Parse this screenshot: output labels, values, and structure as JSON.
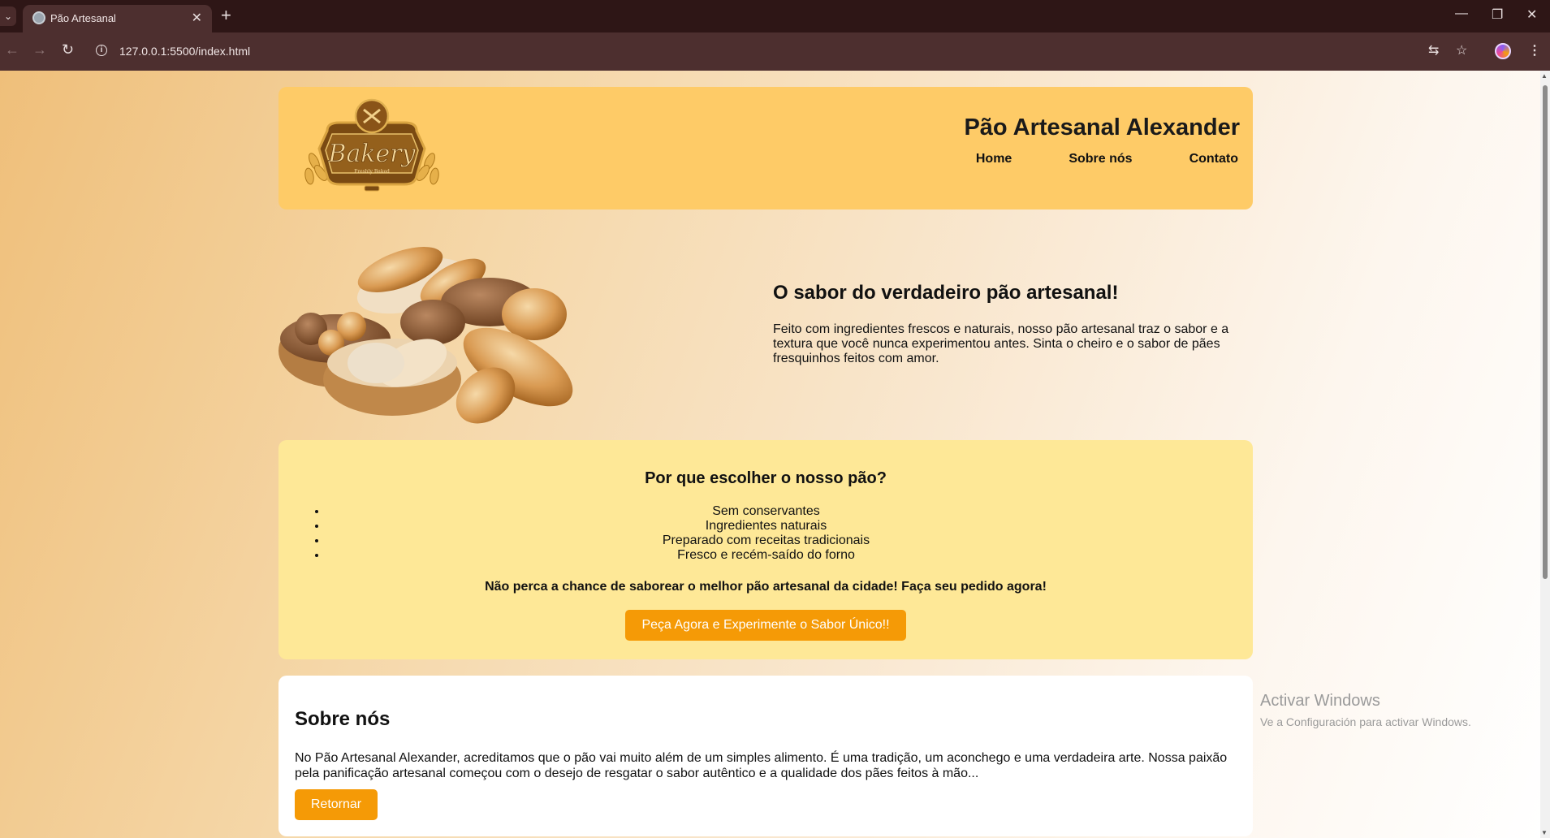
{
  "browser": {
    "tab_title": "Pão Artesanal",
    "url": "127.0.0.1:5500/index.html"
  },
  "header": {
    "logo_text": "Bakery",
    "logo_subtext": "Freshly Baked",
    "site_title": "Pão Artesanal Alexander",
    "nav": [
      "Home",
      "Sobre nós",
      "Contato"
    ]
  },
  "hero": {
    "heading": "O sabor do verdadeiro pão artesanal!",
    "text": "Feito com ingredientes frescos e naturais, nosso pão artesanal traz o sabor e a textura que você nunca experimentou antes. Sinta o cheiro e o sabor de pães fresquinhos feitos com amor."
  },
  "why": {
    "heading": "Por que escolher o nosso pão?",
    "items": [
      "Sem conservantes",
      "Ingredientes naturais",
      "Preparado com receitas tradicionais",
      "Fresco e recém-saído do forno"
    ],
    "cta_text": "Não perca a chance de saborear o melhor pão artesanal da cidade! Faça seu pedido agora!",
    "cta_button": "Peça Agora e Experimente o Sabor Único!!"
  },
  "about": {
    "heading": "Sobre nós",
    "text": "No Pão Artesanal Alexander, acreditamos que o pão vai muito além de um simples alimento. É uma tradição, um aconchego e uma verdadeira arte. Nossa paixão pela panificação artesanal começou com o desejo de resgatar o sabor autêntico e a qualidade dos pães feitos à mão...",
    "button": "Retornar"
  },
  "watermark": {
    "line1": "Activar Windows",
    "line2": "Ve a Configuración para activar Windows."
  },
  "colors": {
    "header_bg": "#fecb67",
    "why_bg": "#fee897",
    "button_bg": "#f59a06",
    "chrome_bg": "#2e1616"
  }
}
